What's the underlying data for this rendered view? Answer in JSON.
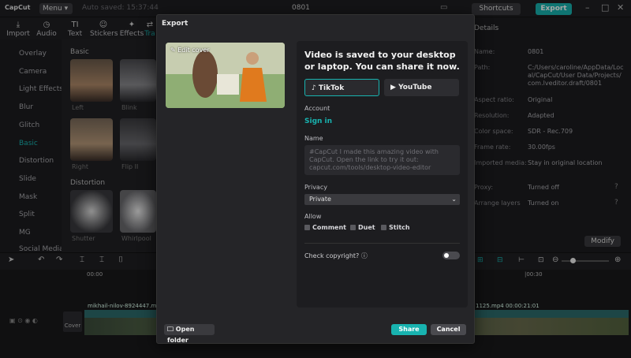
{
  "app": {
    "logo": "CapCut",
    "menu": "Menu",
    "autosave": "Auto saved: 15:37:44",
    "project": "0801",
    "shortcuts": "Shortcuts",
    "export": "Export"
  },
  "toolbar": [
    {
      "label": "Import",
      "icon": "import-icon"
    },
    {
      "label": "Audio",
      "icon": "audio-icon"
    },
    {
      "label": "Text",
      "icon": "text-icon"
    },
    {
      "label": "Stickers",
      "icon": "stickers-icon"
    },
    {
      "label": "Effects",
      "icon": "effects-icon"
    },
    {
      "label": "Tra",
      "icon": "transitions-icon"
    }
  ],
  "sidebar": [
    "Overlay",
    "Camera",
    "Light Effects",
    "Blur",
    "Glitch",
    "Basic",
    "Distortion",
    "Slide",
    "Mask",
    "Split",
    "MG",
    "Social Media"
  ],
  "gallery": {
    "section1": "Basic",
    "items1": [
      "Left",
      "Blink",
      "Right",
      "Flip II"
    ],
    "section2": "Distortion",
    "items2": [
      "Shutter",
      "Whirlpool"
    ]
  },
  "details": {
    "header": "Details",
    "rows": [
      {
        "label": "Name:",
        "value": "0801"
      },
      {
        "label": "Path:",
        "value": "C:/Users/caroline/AppData/Local/CapCut/User Data/Projects/com.lveditor.draft/0801"
      },
      {
        "label": "Aspect ratio:",
        "value": "Original"
      },
      {
        "label": "Resolution:",
        "value": "Adapted"
      },
      {
        "label": "Color space:",
        "value": "SDR - Rec.709"
      },
      {
        "label": "Frame rate:",
        "value": "30.00fps"
      },
      {
        "label": "Imported media:",
        "value": "Stay in original location"
      },
      {
        "label": "Proxy:",
        "value": "Turned off"
      },
      {
        "label": "Arrange layers",
        "value": "Turned on"
      }
    ],
    "modify": "Modify"
  },
  "timeline": {
    "time0": "00:00",
    "time1": "|00:30",
    "cover": "Cover",
    "clip_left": "mikhail-nilov-8924447.mp4",
    "clip_right": "1125.mp4  00:00:21:01"
  },
  "modal": {
    "title": "Export",
    "edit_cover": "Edit cover",
    "headline": "Video is saved to your desktop or laptop. You can share it now.",
    "tiktok": "TikTok",
    "youtube": "YouTube",
    "account_label": "Account",
    "sign_in": "Sign in",
    "name_label": "Name",
    "name_placeholder": "#CapCut I made this amazing video with CapCut. Open the link to try it out: capcut.com/tools/desktop-video-editor",
    "privacy_label": "Privacy",
    "privacy_value": "Private",
    "allow_label": "Allow",
    "allow_options": [
      "Comment",
      "Duet",
      "Stitch"
    ],
    "copyright_label": "Check copyright?",
    "open_folder": "Open folder",
    "share": "Share",
    "cancel": "Cancel"
  },
  "colors": {
    "accent": "#18b3b0",
    "bg": "#1b1b1d",
    "modal": "#252528"
  }
}
